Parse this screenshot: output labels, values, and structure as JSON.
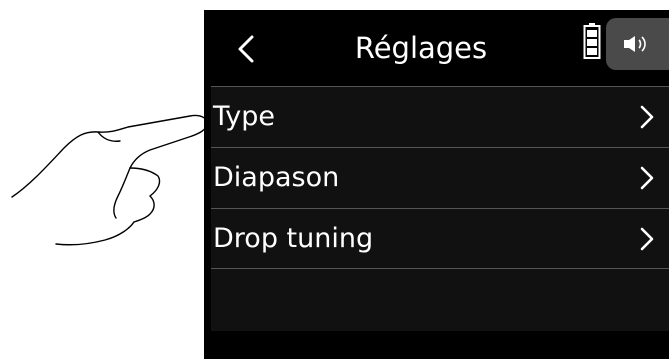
{
  "header": {
    "back_icon": "chevron-left-icon",
    "title": "Réglages",
    "battery_icon": "battery-icon",
    "speaker_icon": "speaker-icon"
  },
  "menu": {
    "items": [
      {
        "label": "Type",
        "icon": "chevron-right-icon"
      },
      {
        "label": "Diapason",
        "icon": "chevron-right-icon"
      },
      {
        "label": "Drop tuning",
        "icon": "chevron-right-icon"
      }
    ]
  },
  "illustration": {
    "icon": "pointing-hand-icon"
  },
  "colors": {
    "screen_bg": "#111111",
    "bar_bg": "#000000",
    "divider": "#555555",
    "text": "#ffffff",
    "speaker_tab": "#4a4a4a"
  }
}
